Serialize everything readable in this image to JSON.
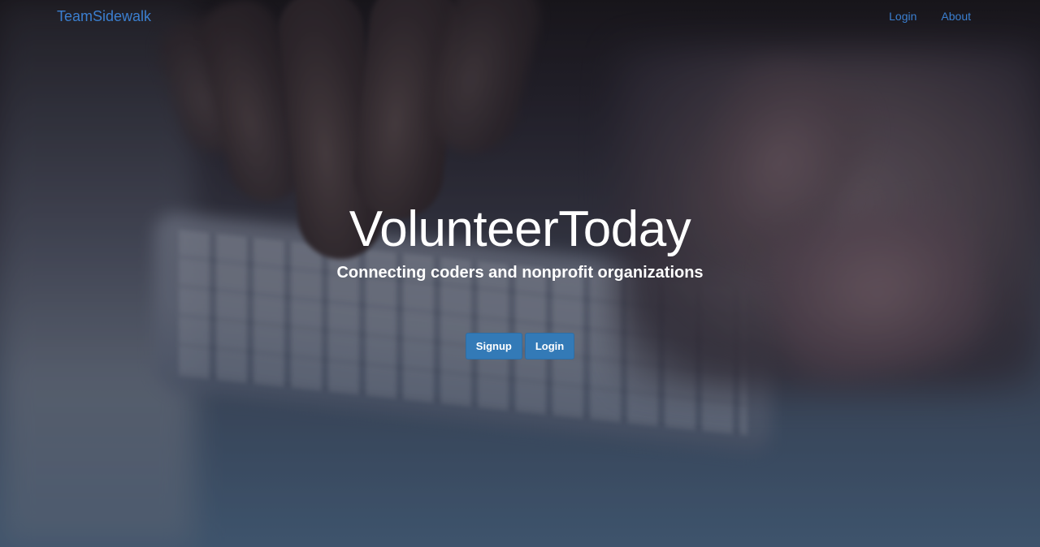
{
  "navbar": {
    "brand": "TeamSidewalk",
    "links": [
      {
        "label": "Login"
      },
      {
        "label": "About"
      }
    ]
  },
  "hero": {
    "title": "VolunteerToday",
    "subtitle": "Connecting coders and nonprofit organizations",
    "buttons": [
      {
        "label": "Signup"
      },
      {
        "label": "Login"
      }
    ]
  },
  "colors": {
    "link": "#3b7fd0",
    "button": "#337ab7",
    "text": "#ffffff"
  }
}
